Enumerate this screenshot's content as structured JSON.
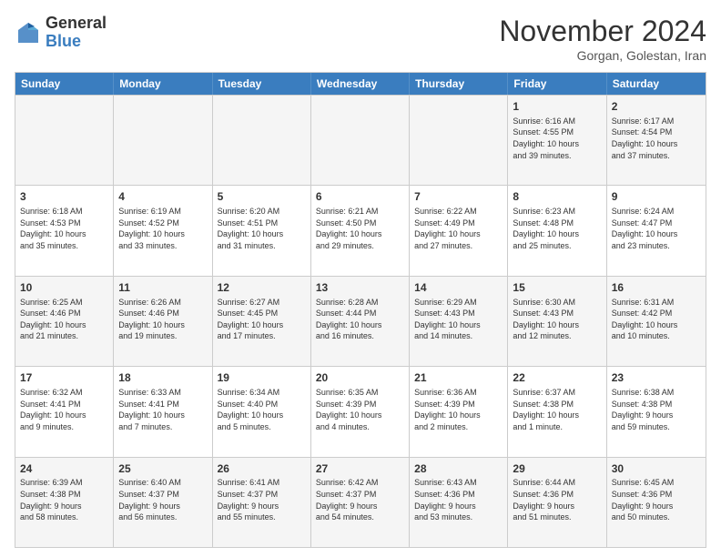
{
  "logo": {
    "general": "General",
    "blue": "Blue"
  },
  "header": {
    "month": "November 2024",
    "location": "Gorgan, Golestan, Iran"
  },
  "weekdays": [
    "Sunday",
    "Monday",
    "Tuesday",
    "Wednesday",
    "Thursday",
    "Friday",
    "Saturday"
  ],
  "rows": [
    [
      {
        "day": "",
        "lines": []
      },
      {
        "day": "",
        "lines": []
      },
      {
        "day": "",
        "lines": []
      },
      {
        "day": "",
        "lines": []
      },
      {
        "day": "",
        "lines": []
      },
      {
        "day": "1",
        "lines": [
          "Sunrise: 6:16 AM",
          "Sunset: 4:55 PM",
          "Daylight: 10 hours",
          "and 39 minutes."
        ]
      },
      {
        "day": "2",
        "lines": [
          "Sunrise: 6:17 AM",
          "Sunset: 4:54 PM",
          "Daylight: 10 hours",
          "and 37 minutes."
        ]
      }
    ],
    [
      {
        "day": "3",
        "lines": [
          "Sunrise: 6:18 AM",
          "Sunset: 4:53 PM",
          "Daylight: 10 hours",
          "and 35 minutes."
        ]
      },
      {
        "day": "4",
        "lines": [
          "Sunrise: 6:19 AM",
          "Sunset: 4:52 PM",
          "Daylight: 10 hours",
          "and 33 minutes."
        ]
      },
      {
        "day": "5",
        "lines": [
          "Sunrise: 6:20 AM",
          "Sunset: 4:51 PM",
          "Daylight: 10 hours",
          "and 31 minutes."
        ]
      },
      {
        "day": "6",
        "lines": [
          "Sunrise: 6:21 AM",
          "Sunset: 4:50 PM",
          "Daylight: 10 hours",
          "and 29 minutes."
        ]
      },
      {
        "day": "7",
        "lines": [
          "Sunrise: 6:22 AM",
          "Sunset: 4:49 PM",
          "Daylight: 10 hours",
          "and 27 minutes."
        ]
      },
      {
        "day": "8",
        "lines": [
          "Sunrise: 6:23 AM",
          "Sunset: 4:48 PM",
          "Daylight: 10 hours",
          "and 25 minutes."
        ]
      },
      {
        "day": "9",
        "lines": [
          "Sunrise: 6:24 AM",
          "Sunset: 4:47 PM",
          "Daylight: 10 hours",
          "and 23 minutes."
        ]
      }
    ],
    [
      {
        "day": "10",
        "lines": [
          "Sunrise: 6:25 AM",
          "Sunset: 4:46 PM",
          "Daylight: 10 hours",
          "and 21 minutes."
        ]
      },
      {
        "day": "11",
        "lines": [
          "Sunrise: 6:26 AM",
          "Sunset: 4:46 PM",
          "Daylight: 10 hours",
          "and 19 minutes."
        ]
      },
      {
        "day": "12",
        "lines": [
          "Sunrise: 6:27 AM",
          "Sunset: 4:45 PM",
          "Daylight: 10 hours",
          "and 17 minutes."
        ]
      },
      {
        "day": "13",
        "lines": [
          "Sunrise: 6:28 AM",
          "Sunset: 4:44 PM",
          "Daylight: 10 hours",
          "and 16 minutes."
        ]
      },
      {
        "day": "14",
        "lines": [
          "Sunrise: 6:29 AM",
          "Sunset: 4:43 PM",
          "Daylight: 10 hours",
          "and 14 minutes."
        ]
      },
      {
        "day": "15",
        "lines": [
          "Sunrise: 6:30 AM",
          "Sunset: 4:43 PM",
          "Daylight: 10 hours",
          "and 12 minutes."
        ]
      },
      {
        "day": "16",
        "lines": [
          "Sunrise: 6:31 AM",
          "Sunset: 4:42 PM",
          "Daylight: 10 hours",
          "and 10 minutes."
        ]
      }
    ],
    [
      {
        "day": "17",
        "lines": [
          "Sunrise: 6:32 AM",
          "Sunset: 4:41 PM",
          "Daylight: 10 hours",
          "and 9 minutes."
        ]
      },
      {
        "day": "18",
        "lines": [
          "Sunrise: 6:33 AM",
          "Sunset: 4:41 PM",
          "Daylight: 10 hours",
          "and 7 minutes."
        ]
      },
      {
        "day": "19",
        "lines": [
          "Sunrise: 6:34 AM",
          "Sunset: 4:40 PM",
          "Daylight: 10 hours",
          "and 5 minutes."
        ]
      },
      {
        "day": "20",
        "lines": [
          "Sunrise: 6:35 AM",
          "Sunset: 4:39 PM",
          "Daylight: 10 hours",
          "and 4 minutes."
        ]
      },
      {
        "day": "21",
        "lines": [
          "Sunrise: 6:36 AM",
          "Sunset: 4:39 PM",
          "Daylight: 10 hours",
          "and 2 minutes."
        ]
      },
      {
        "day": "22",
        "lines": [
          "Sunrise: 6:37 AM",
          "Sunset: 4:38 PM",
          "Daylight: 10 hours",
          "and 1 minute."
        ]
      },
      {
        "day": "23",
        "lines": [
          "Sunrise: 6:38 AM",
          "Sunset: 4:38 PM",
          "Daylight: 9 hours",
          "and 59 minutes."
        ]
      }
    ],
    [
      {
        "day": "24",
        "lines": [
          "Sunrise: 6:39 AM",
          "Sunset: 4:38 PM",
          "Daylight: 9 hours",
          "and 58 minutes."
        ]
      },
      {
        "day": "25",
        "lines": [
          "Sunrise: 6:40 AM",
          "Sunset: 4:37 PM",
          "Daylight: 9 hours",
          "and 56 minutes."
        ]
      },
      {
        "day": "26",
        "lines": [
          "Sunrise: 6:41 AM",
          "Sunset: 4:37 PM",
          "Daylight: 9 hours",
          "and 55 minutes."
        ]
      },
      {
        "day": "27",
        "lines": [
          "Sunrise: 6:42 AM",
          "Sunset: 4:37 PM",
          "Daylight: 9 hours",
          "and 54 minutes."
        ]
      },
      {
        "day": "28",
        "lines": [
          "Sunrise: 6:43 AM",
          "Sunset: 4:36 PM",
          "Daylight: 9 hours",
          "and 53 minutes."
        ]
      },
      {
        "day": "29",
        "lines": [
          "Sunrise: 6:44 AM",
          "Sunset: 4:36 PM",
          "Daylight: 9 hours",
          "and 51 minutes."
        ]
      },
      {
        "day": "30",
        "lines": [
          "Sunrise: 6:45 AM",
          "Sunset: 4:36 PM",
          "Daylight: 9 hours",
          "and 50 minutes."
        ]
      }
    ]
  ]
}
